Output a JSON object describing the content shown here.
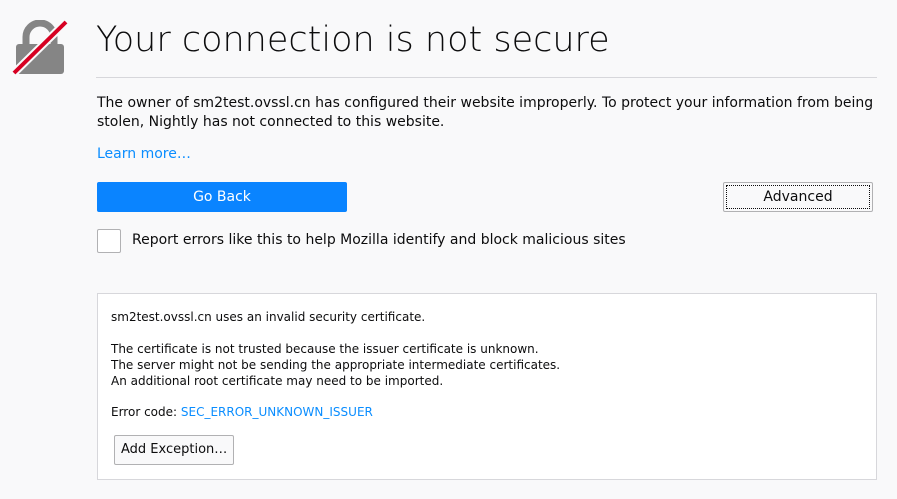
{
  "page": {
    "title": "Your connection is not secure",
    "description": "The owner of sm2test.ovssl.cn has configured their website improperly. To protect your information from being stolen, Nightly has not connected to this website.",
    "learn_more": "Learn more…",
    "lock_icon": "broken-lock-icon"
  },
  "buttons": {
    "go_back": "Go Back",
    "advanced": "Advanced"
  },
  "report": {
    "checked": false,
    "label": "Report errors like this to help Mozilla identify and block malicious sites"
  },
  "details": {
    "summary": "sm2test.ovssl.cn uses an invalid security certificate.",
    "reason_lines": [
      "The certificate is not trusted because the issuer certificate is unknown.",
      "The server might not be sending the appropriate intermediate certificates.",
      "An additional root certificate may need to be imported."
    ],
    "error_code_prefix": "Error code: ",
    "error_code": "SEC_ERROR_UNKNOWN_ISSUER",
    "add_exception": "Add Exception…"
  },
  "colors": {
    "primary_button": "#0a84ff",
    "link": "#0a8dff",
    "lock_gray": "#858585",
    "lock_strike": "#d70022",
    "background": "#f9f9fa"
  }
}
